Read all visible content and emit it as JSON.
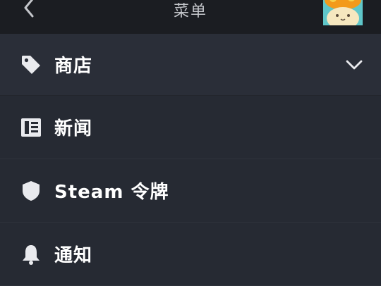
{
  "header": {
    "title": "菜单",
    "back_icon": "chevron-left-icon",
    "avatar_icon": "user-avatar"
  },
  "menu": {
    "items": [
      {
        "label": "商店",
        "icon": "tag-icon",
        "expandable": true,
        "chevron_icon": "chevron-down-icon"
      },
      {
        "label": "新闻",
        "icon": "newspaper-icon"
      },
      {
        "label": "Steam 令牌",
        "icon": "shield-icon"
      },
      {
        "label": "通知",
        "icon": "bell-icon"
      }
    ]
  },
  "colors": {
    "header_bg": "#1b1d22",
    "page_bg": "#262a33",
    "store_bg": "#2a2e38",
    "text": "#ffffff"
  }
}
